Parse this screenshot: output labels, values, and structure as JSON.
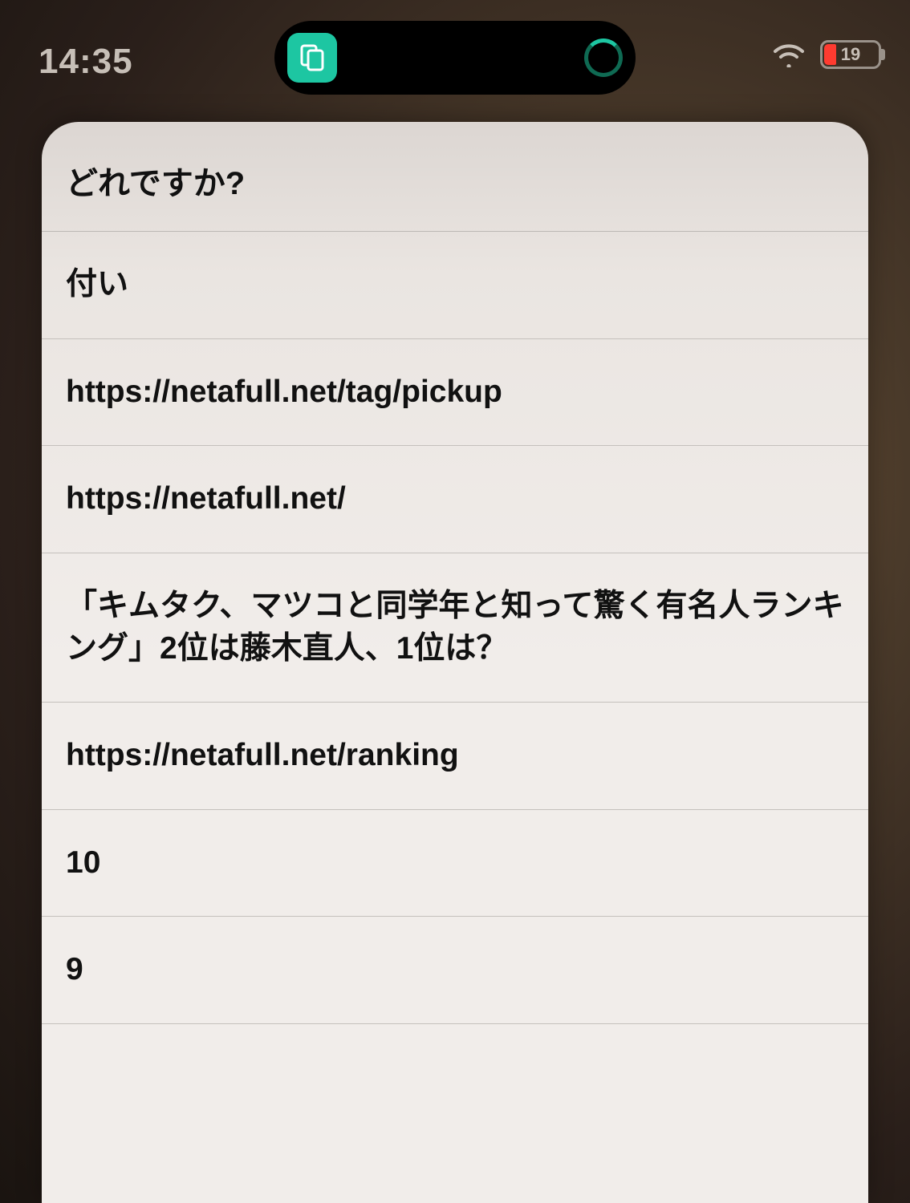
{
  "status": {
    "time": "14:35",
    "battery_percent": "19"
  },
  "sheet": {
    "title": "どれですか?",
    "options": [
      "付い",
      "https://netafull.net/tag/pickup",
      "https://netafull.net/",
      "「キムタク、マツコと同学年と知って驚く有名人ランキング」2位は藤木直人、1位は？",
      "https://netafull.net/ranking",
      "10",
      "9"
    ]
  }
}
